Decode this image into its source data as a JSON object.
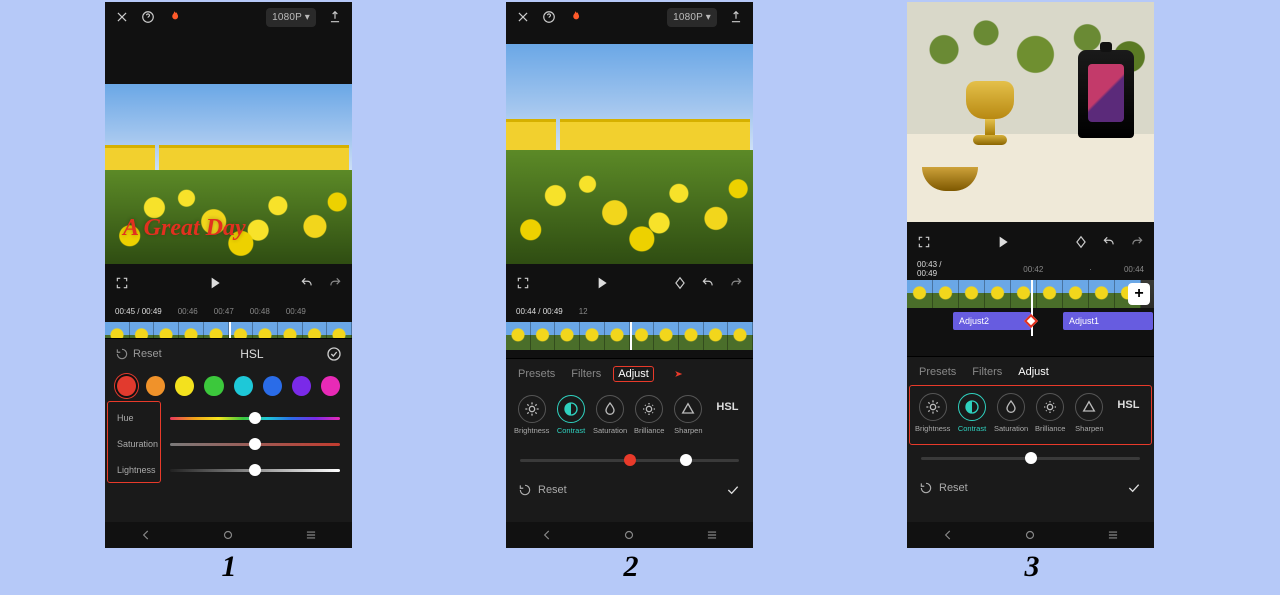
{
  "badge": {
    "resolution": "1080P ▾"
  },
  "step_labels": {
    "s1": "1",
    "s2": "2",
    "s3": "3"
  },
  "p1": {
    "overlay_title": "A Great Day",
    "tline": {
      "cur": "00:45",
      "dur": "00:49",
      "marks": [
        "00:45",
        "00:46",
        "00:47",
        "00:48",
        "00:49"
      ]
    },
    "hdr": {
      "reset": "Reset",
      "title": "HSL"
    },
    "swatches": [
      "#e23a2e",
      "#f0922a",
      "#f3e11e",
      "#3cc83c",
      "#1ec8d8",
      "#2a6ce8",
      "#7a2ae8",
      "#e82ab6"
    ],
    "sliders": [
      "Hue",
      "Saturation",
      "Lightness"
    ]
  },
  "p2": {
    "tline": {
      "cur": "00:44",
      "dur": "00:49",
      "marks": [
        "12",
        "",
        "",
        "",
        ""
      ]
    },
    "tabs": [
      "Presets",
      "Filters",
      "Adjust"
    ],
    "adj_items": [
      "Brightness",
      "Contrast",
      "Saturation",
      "Brilliance",
      "Sharpen",
      "HSL"
    ],
    "reset": "Reset"
  },
  "p3": {
    "tline": {
      "cur": "00:43",
      "dur": "00:49",
      "marks": [
        "00:42",
        "00:43",
        "00:44"
      ]
    },
    "segments": [
      "Adjust2",
      "Adjust1"
    ],
    "tabs": [
      "Presets",
      "Filters",
      "Adjust"
    ],
    "adj_items": [
      "Brightness",
      "Contrast",
      "Saturation",
      "Brilliance",
      "Sharpen",
      "HSL"
    ],
    "reset": "Reset"
  }
}
